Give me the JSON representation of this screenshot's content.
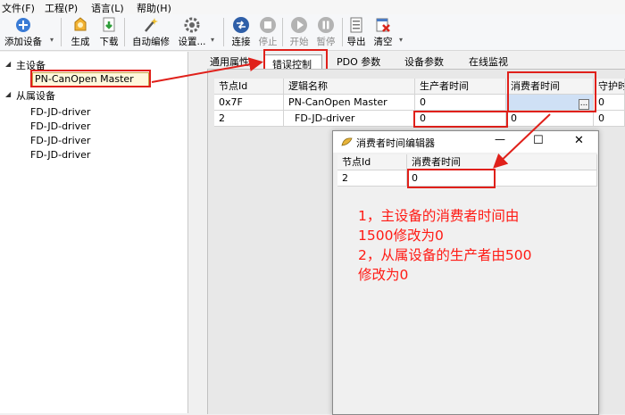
{
  "menu": {
    "file": "文件(F)",
    "project": "工程(P)",
    "language": "语言(L)",
    "help": "帮助(H)"
  },
  "toolbar": {
    "add_device": "添加设备",
    "generate": "生成",
    "download": "下载",
    "auto_address": "自动编修",
    "settings": "设置...",
    "connect": "连接",
    "stop": "停止",
    "start": "开始",
    "pause": "暂停",
    "export": "导出",
    "clear": "清空"
  },
  "tree": {
    "master_group": "主设备",
    "master_node": "PN-CanOpen Master",
    "slave_group": "从属设备",
    "slaves": [
      "FD-JD-driver",
      "FD-JD-driver",
      "FD-JD-driver",
      "FD-JD-driver"
    ]
  },
  "tabs": [
    "通用属性",
    "错误控制",
    "PDO 参数",
    "设备参数",
    "在线监视"
  ],
  "grid": {
    "columns": [
      "节点Id",
      "逻辑名称",
      "生产者时间",
      "消费者时间",
      "守护时"
    ],
    "rows": [
      [
        "0x7F",
        "PN-CanOpen Master",
        "0",
        "",
        "0"
      ],
      [
        "2",
        "FD-JD-driver",
        "0",
        "0",
        "0"
      ]
    ],
    "ellipsis": "..."
  },
  "dialog": {
    "title": "消费者时间编辑器",
    "columns": [
      "节点Id",
      "消费者时间"
    ],
    "rows": [
      [
        "2",
        "0"
      ]
    ],
    "min_glyph": "—",
    "max_glyph": "☐",
    "close_glyph": "✕"
  },
  "annotation": {
    "lines": [
      "1，主设备的消费者时间由",
      "1500修改为0",
      "2，从属设备的生产者由500",
      "修改为0"
    ]
  },
  "colors": {
    "annotation_red": "#e0201a",
    "master_highlight": "#fff8dc"
  }
}
